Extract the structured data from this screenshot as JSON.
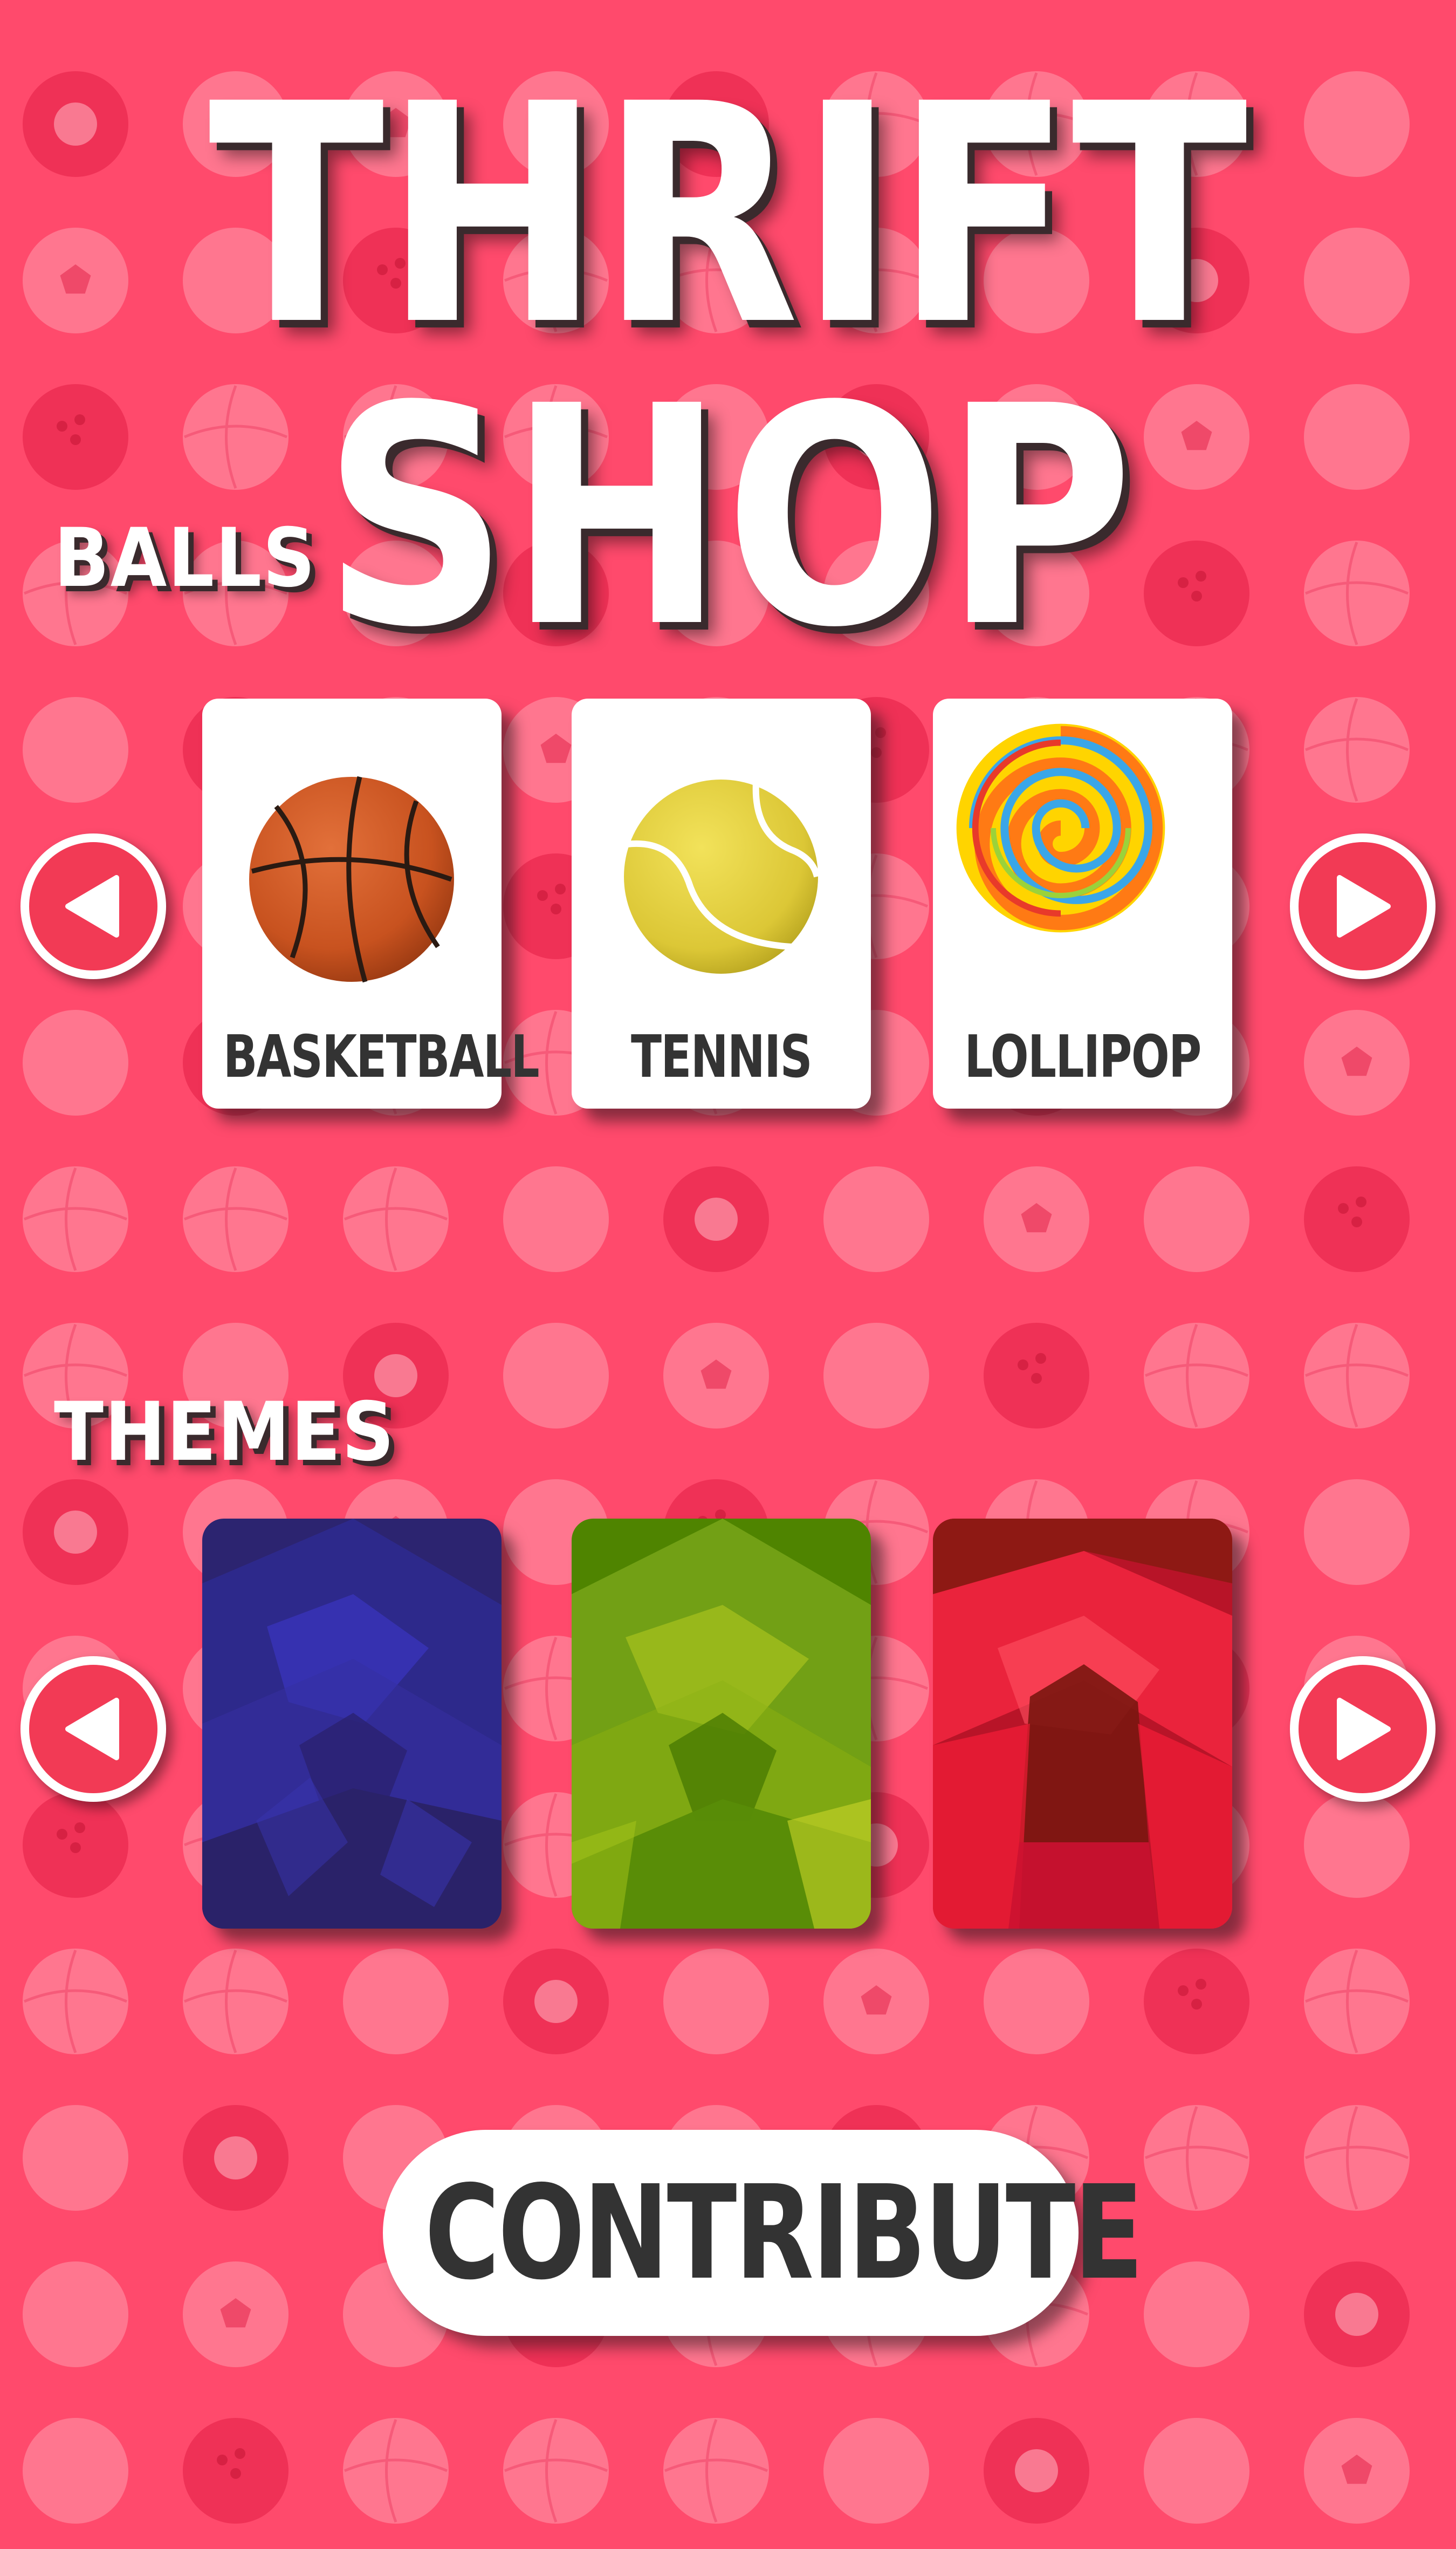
{
  "title": "THRIFT SHOP",
  "background_color": "#ff4a6c",
  "balls_section": {
    "title": "BALLS",
    "items": [
      {
        "label": "BASKETBALL",
        "icon": "basketball-icon"
      },
      {
        "label": "TENNIS",
        "icon": "tennis-ball-icon"
      },
      {
        "label": "LOLLIPOP",
        "icon": "lollipop-icon"
      }
    ],
    "prev_icon": "arrow-left-icon",
    "next_icon": "arrow-right-icon"
  },
  "themes_section": {
    "title": "THEMES",
    "items": [
      {
        "name": "blue-theme",
        "color": "#2a2370",
        "accent": "#3a34c0"
      },
      {
        "name": "green-theme",
        "color": "#4a7d00",
        "accent": "#a8c61a"
      },
      {
        "name": "red-theme",
        "color": "#8a1a12",
        "accent": "#ff1e3a"
      }
    ],
    "prev_icon": "arrow-left-icon",
    "next_icon": "arrow-right-icon"
  },
  "contribute_button": {
    "label": "CONTRIBUTE"
  },
  "colors": {
    "accent": "#f23a55",
    "card": "#ffffff",
    "text_dark": "#333333"
  }
}
